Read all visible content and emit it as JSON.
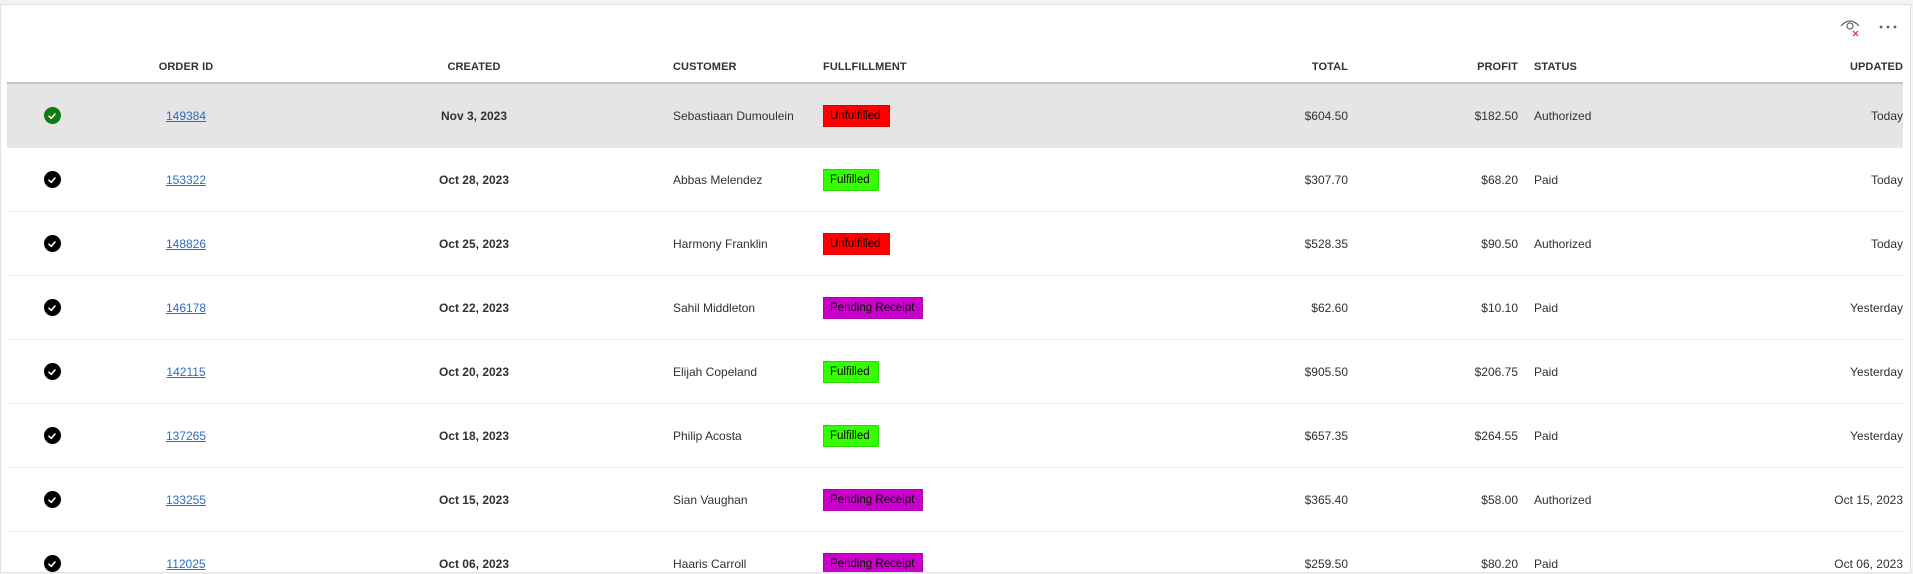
{
  "header": {
    "columns": {
      "order_id": "ORDER ID",
      "created": "CREATED",
      "customer": "CUSTOMER",
      "fulfillment": "FULLFILLMENT",
      "total": "TOTAL",
      "profit": "PROFIT",
      "status": "STATUS",
      "updated": "UPDATED"
    }
  },
  "toolbar": {
    "icons": [
      "eye-hide-icon",
      "more-options-icon"
    ]
  },
  "colors": {
    "unfulfilled": "#ff0000",
    "fulfilled": "#33ff00",
    "pending_receipt": "#cc00cc",
    "selected_check": "#107c10",
    "check": "#000000",
    "link": "#2d6cc0"
  },
  "rows": [
    {
      "order_id": "149384",
      "created": "Nov 3, 2023",
      "customer": "Sebastiaan Dumoulein",
      "fulfillment": "Unfulfilled",
      "fulfillment_color": "#ff0000",
      "total": "$604.50",
      "profit": "$182.50",
      "status": "Authorized",
      "updated": "Today",
      "selected": true
    },
    {
      "order_id": "153322",
      "created": "Oct 28, 2023",
      "customer": "Abbas Melendez",
      "fulfillment": "Fulfilled",
      "fulfillment_color": "#33ff00",
      "total": "$307.70",
      "profit": "$68.20",
      "status": "Paid",
      "updated": "Today",
      "selected": false
    },
    {
      "order_id": "148826",
      "created": "Oct 25, 2023",
      "customer": "Harmony Franklin",
      "fulfillment": "Unfulfilled",
      "fulfillment_color": "#ff0000",
      "total": "$528.35",
      "profit": "$90.50",
      "status": "Authorized",
      "updated": "Today",
      "selected": false
    },
    {
      "order_id": "146178",
      "created": "Oct 22, 2023",
      "customer": "Sahil Middleton",
      "fulfillment": "Pending Receipt",
      "fulfillment_color": "#cc00cc",
      "total": "$62.60",
      "profit": "$10.10",
      "status": "Paid",
      "updated": "Yesterday",
      "selected": false
    },
    {
      "order_id": "142115",
      "created": "Oct 20, 2023",
      "customer": "Elijah Copeland",
      "fulfillment": "Fulfilled",
      "fulfillment_color": "#33ff00",
      "total": "$905.50",
      "profit": "$206.75",
      "status": "Paid",
      "updated": "Yesterday",
      "selected": false
    },
    {
      "order_id": "137265",
      "created": "Oct 18, 2023",
      "customer": "Philip Acosta",
      "fulfillment": "Fulfilled",
      "fulfillment_color": "#33ff00",
      "total": "$657.35",
      "profit": "$264.55",
      "status": "Paid",
      "updated": "Yesterday",
      "selected": false
    },
    {
      "order_id": "133255",
      "created": "Oct 15, 2023",
      "customer": "Sian Vaughan",
      "fulfillment": "Pending Receipt",
      "fulfillment_color": "#cc00cc",
      "total": "$365.40",
      "profit": "$58.00",
      "status": "Authorized",
      "updated": "Oct 15, 2023",
      "selected": false
    },
    {
      "order_id": "112025",
      "created": "Oct 06, 2023",
      "customer": "Haaris Carroll",
      "fulfillment": "Pending Receipt",
      "fulfillment_color": "#cc00cc",
      "total": "$259.50",
      "profit": "$80.20",
      "status": "Paid",
      "updated": "Oct 06, 2023",
      "selected": false
    }
  ]
}
